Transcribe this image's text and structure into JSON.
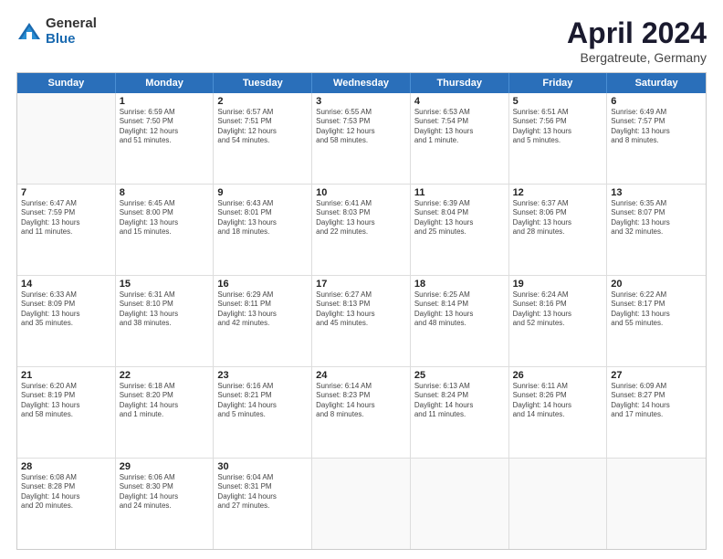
{
  "logo": {
    "general": "General",
    "blue": "Blue"
  },
  "title": "April 2024",
  "location": "Bergatreute, Germany",
  "weekdays": [
    "Sunday",
    "Monday",
    "Tuesday",
    "Wednesday",
    "Thursday",
    "Friday",
    "Saturday"
  ],
  "rows": [
    [
      {
        "day": "",
        "lines": []
      },
      {
        "day": "1",
        "lines": [
          "Sunrise: 6:59 AM",
          "Sunset: 7:50 PM",
          "Daylight: 12 hours",
          "and 51 minutes."
        ]
      },
      {
        "day": "2",
        "lines": [
          "Sunrise: 6:57 AM",
          "Sunset: 7:51 PM",
          "Daylight: 12 hours",
          "and 54 minutes."
        ]
      },
      {
        "day": "3",
        "lines": [
          "Sunrise: 6:55 AM",
          "Sunset: 7:53 PM",
          "Daylight: 12 hours",
          "and 58 minutes."
        ]
      },
      {
        "day": "4",
        "lines": [
          "Sunrise: 6:53 AM",
          "Sunset: 7:54 PM",
          "Daylight: 13 hours",
          "and 1 minute."
        ]
      },
      {
        "day": "5",
        "lines": [
          "Sunrise: 6:51 AM",
          "Sunset: 7:56 PM",
          "Daylight: 13 hours",
          "and 5 minutes."
        ]
      },
      {
        "day": "6",
        "lines": [
          "Sunrise: 6:49 AM",
          "Sunset: 7:57 PM",
          "Daylight: 13 hours",
          "and 8 minutes."
        ]
      }
    ],
    [
      {
        "day": "7",
        "lines": [
          "Sunrise: 6:47 AM",
          "Sunset: 7:59 PM",
          "Daylight: 13 hours",
          "and 11 minutes."
        ]
      },
      {
        "day": "8",
        "lines": [
          "Sunrise: 6:45 AM",
          "Sunset: 8:00 PM",
          "Daylight: 13 hours",
          "and 15 minutes."
        ]
      },
      {
        "day": "9",
        "lines": [
          "Sunrise: 6:43 AM",
          "Sunset: 8:01 PM",
          "Daylight: 13 hours",
          "and 18 minutes."
        ]
      },
      {
        "day": "10",
        "lines": [
          "Sunrise: 6:41 AM",
          "Sunset: 8:03 PM",
          "Daylight: 13 hours",
          "and 22 minutes."
        ]
      },
      {
        "day": "11",
        "lines": [
          "Sunrise: 6:39 AM",
          "Sunset: 8:04 PM",
          "Daylight: 13 hours",
          "and 25 minutes."
        ]
      },
      {
        "day": "12",
        "lines": [
          "Sunrise: 6:37 AM",
          "Sunset: 8:06 PM",
          "Daylight: 13 hours",
          "and 28 minutes."
        ]
      },
      {
        "day": "13",
        "lines": [
          "Sunrise: 6:35 AM",
          "Sunset: 8:07 PM",
          "Daylight: 13 hours",
          "and 32 minutes."
        ]
      }
    ],
    [
      {
        "day": "14",
        "lines": [
          "Sunrise: 6:33 AM",
          "Sunset: 8:09 PM",
          "Daylight: 13 hours",
          "and 35 minutes."
        ]
      },
      {
        "day": "15",
        "lines": [
          "Sunrise: 6:31 AM",
          "Sunset: 8:10 PM",
          "Daylight: 13 hours",
          "and 38 minutes."
        ]
      },
      {
        "day": "16",
        "lines": [
          "Sunrise: 6:29 AM",
          "Sunset: 8:11 PM",
          "Daylight: 13 hours",
          "and 42 minutes."
        ]
      },
      {
        "day": "17",
        "lines": [
          "Sunrise: 6:27 AM",
          "Sunset: 8:13 PM",
          "Daylight: 13 hours",
          "and 45 minutes."
        ]
      },
      {
        "day": "18",
        "lines": [
          "Sunrise: 6:25 AM",
          "Sunset: 8:14 PM",
          "Daylight: 13 hours",
          "and 48 minutes."
        ]
      },
      {
        "day": "19",
        "lines": [
          "Sunrise: 6:24 AM",
          "Sunset: 8:16 PM",
          "Daylight: 13 hours",
          "and 52 minutes."
        ]
      },
      {
        "day": "20",
        "lines": [
          "Sunrise: 6:22 AM",
          "Sunset: 8:17 PM",
          "Daylight: 13 hours",
          "and 55 minutes."
        ]
      }
    ],
    [
      {
        "day": "21",
        "lines": [
          "Sunrise: 6:20 AM",
          "Sunset: 8:19 PM",
          "Daylight: 13 hours",
          "and 58 minutes."
        ]
      },
      {
        "day": "22",
        "lines": [
          "Sunrise: 6:18 AM",
          "Sunset: 8:20 PM",
          "Daylight: 14 hours",
          "and 1 minute."
        ]
      },
      {
        "day": "23",
        "lines": [
          "Sunrise: 6:16 AM",
          "Sunset: 8:21 PM",
          "Daylight: 14 hours",
          "and 5 minutes."
        ]
      },
      {
        "day": "24",
        "lines": [
          "Sunrise: 6:14 AM",
          "Sunset: 8:23 PM",
          "Daylight: 14 hours",
          "and 8 minutes."
        ]
      },
      {
        "day": "25",
        "lines": [
          "Sunrise: 6:13 AM",
          "Sunset: 8:24 PM",
          "Daylight: 14 hours",
          "and 11 minutes."
        ]
      },
      {
        "day": "26",
        "lines": [
          "Sunrise: 6:11 AM",
          "Sunset: 8:26 PM",
          "Daylight: 14 hours",
          "and 14 minutes."
        ]
      },
      {
        "day": "27",
        "lines": [
          "Sunrise: 6:09 AM",
          "Sunset: 8:27 PM",
          "Daylight: 14 hours",
          "and 17 minutes."
        ]
      }
    ],
    [
      {
        "day": "28",
        "lines": [
          "Sunrise: 6:08 AM",
          "Sunset: 8:28 PM",
          "Daylight: 14 hours",
          "and 20 minutes."
        ]
      },
      {
        "day": "29",
        "lines": [
          "Sunrise: 6:06 AM",
          "Sunset: 8:30 PM",
          "Daylight: 14 hours",
          "and 24 minutes."
        ]
      },
      {
        "day": "30",
        "lines": [
          "Sunrise: 6:04 AM",
          "Sunset: 8:31 PM",
          "Daylight: 14 hours",
          "and 27 minutes."
        ]
      },
      {
        "day": "",
        "lines": []
      },
      {
        "day": "",
        "lines": []
      },
      {
        "day": "",
        "lines": []
      },
      {
        "day": "",
        "lines": []
      }
    ]
  ]
}
